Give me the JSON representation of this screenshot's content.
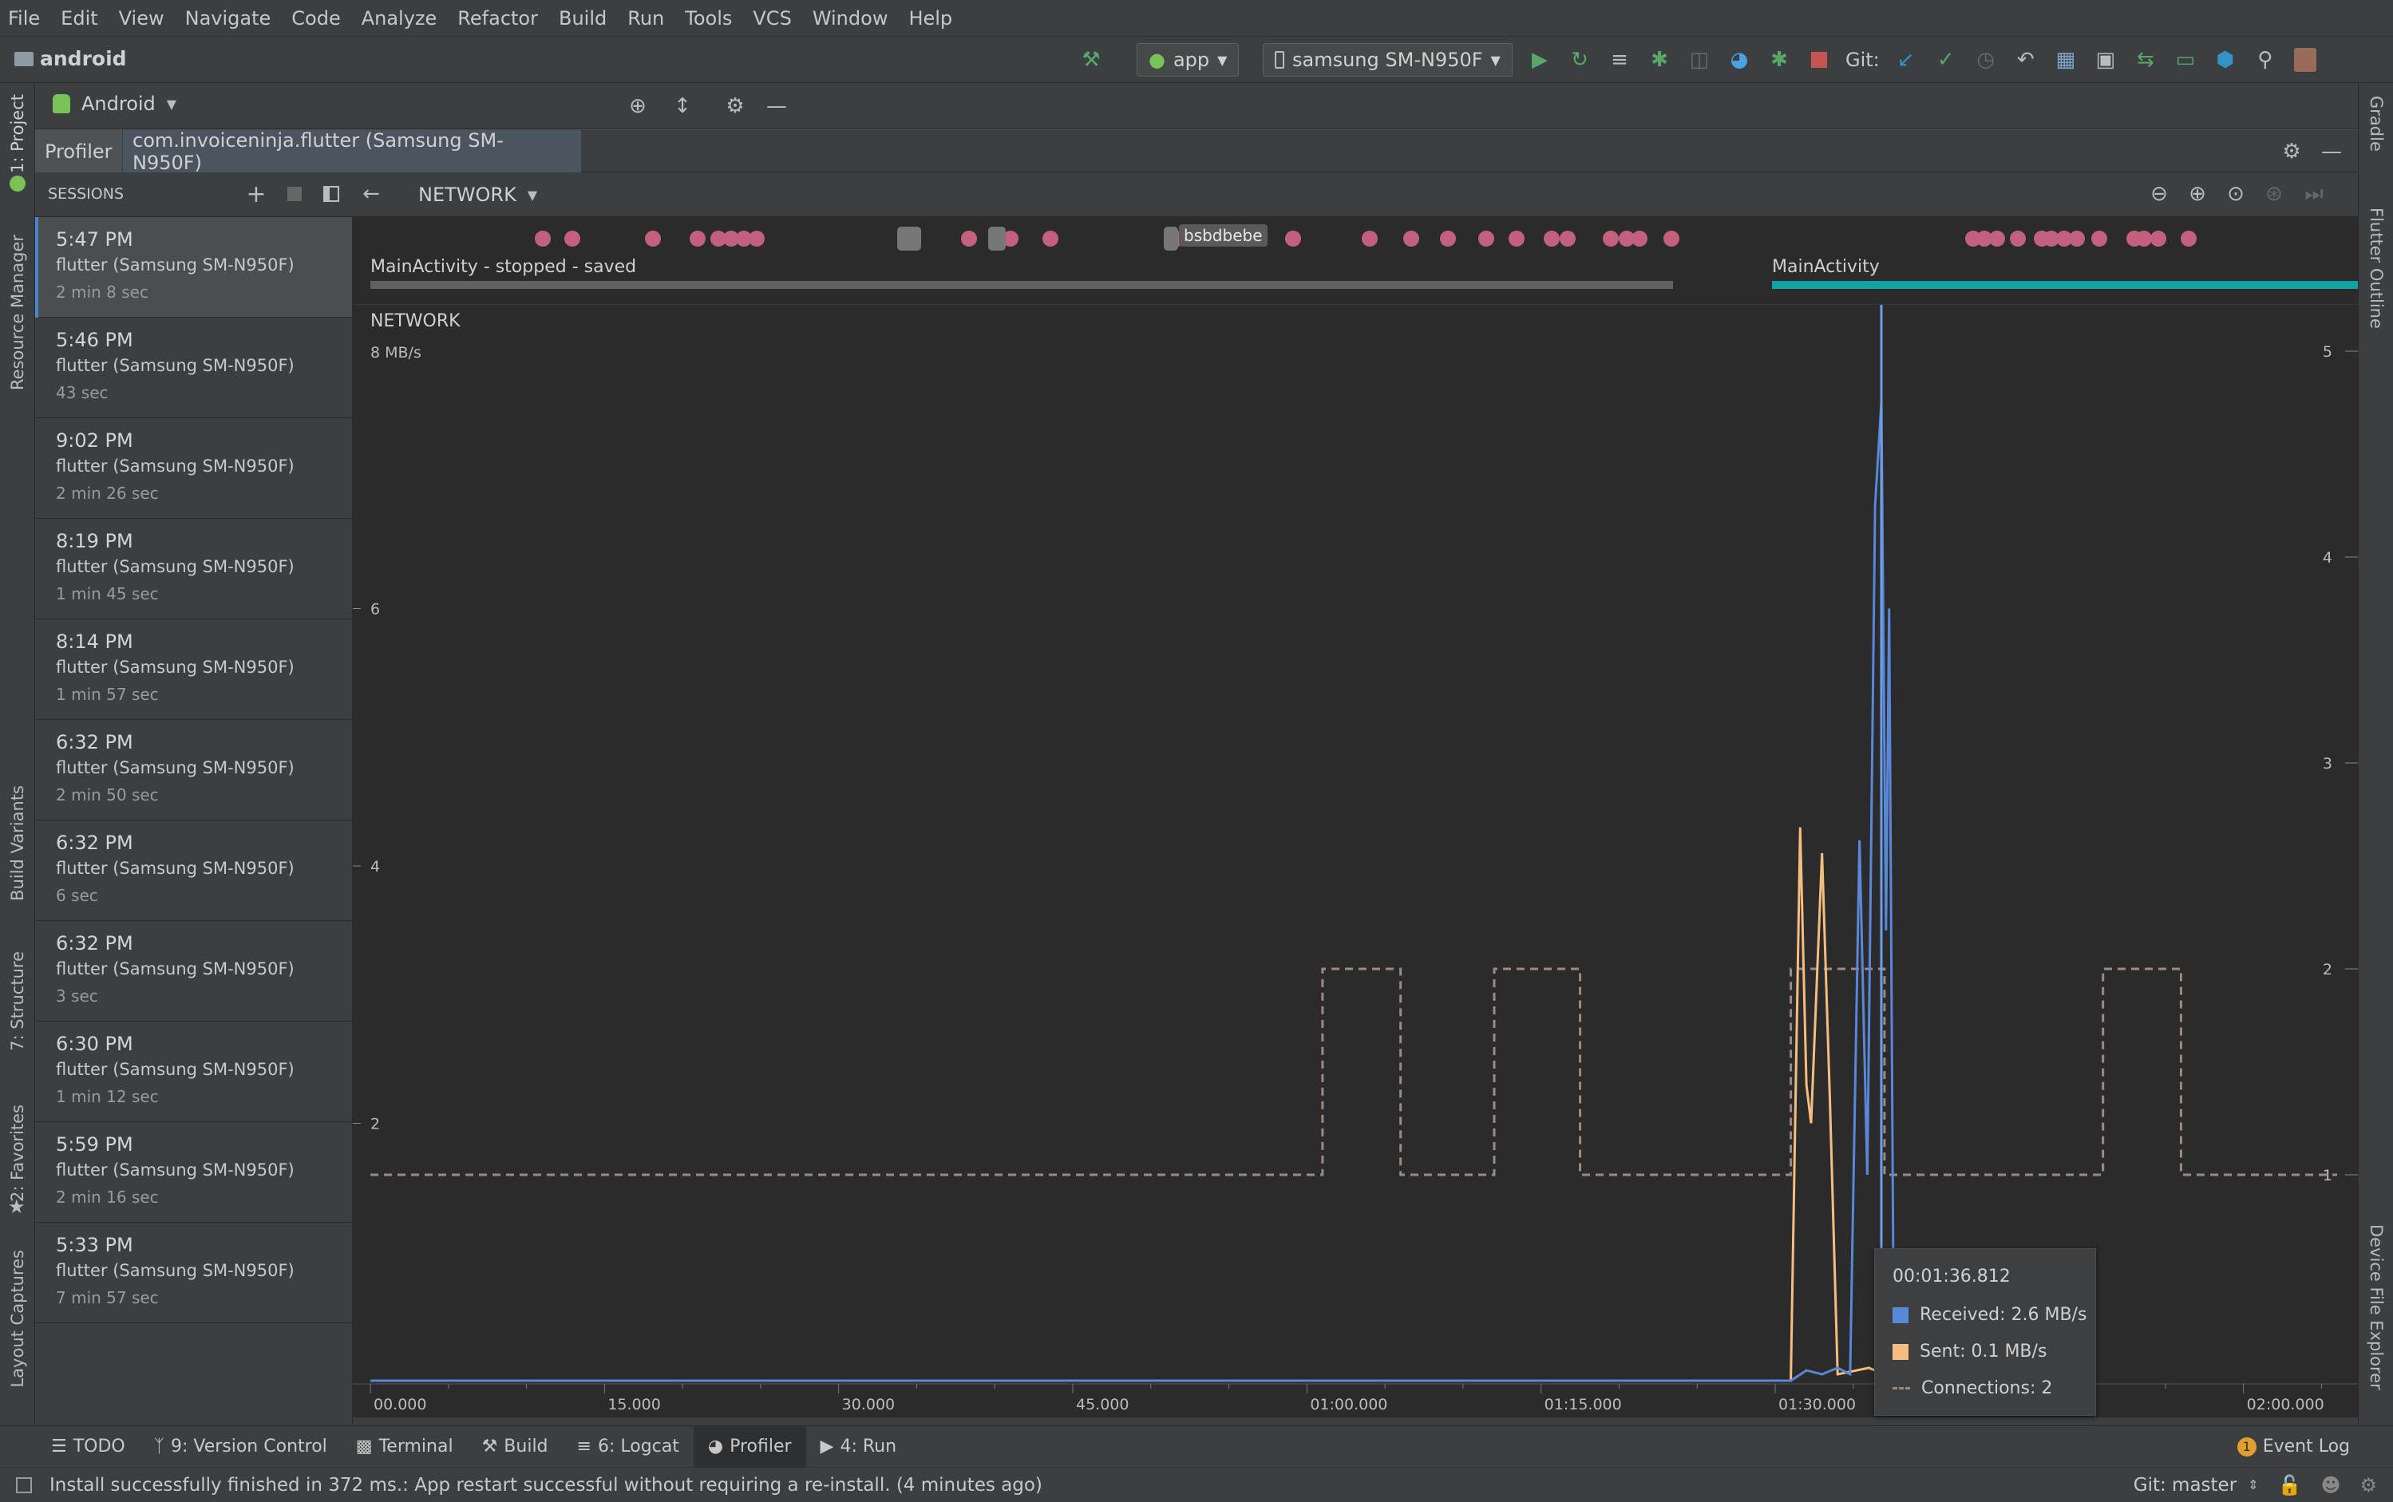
{
  "menu": [
    "File",
    "Edit",
    "View",
    "Navigate",
    "Code",
    "Analyze",
    "Refactor",
    "Build",
    "Run",
    "Tools",
    "VCS",
    "Window",
    "Help"
  ],
  "project_name": "android",
  "run_config": "app",
  "device": "samsung SM-N950F",
  "git_label": "Git:",
  "project_view": "Android",
  "left_tools": {
    "project": "1: Project",
    "resource": "Resource Manager",
    "variants": "Build Variants",
    "structure": "7: Structure",
    "favorites": "2: Favorites",
    "captures": "Layout Captures"
  },
  "right_tools": {
    "gradle": "Gradle",
    "flutter": "Flutter Outline",
    "device": "Device File Explorer"
  },
  "profiler_tabs": {
    "profiler": "Profiler",
    "process": "com.invoiceninja.flutter (Samsung SM-N950F)"
  },
  "sessions_label": "SESSIONS",
  "sessions": [
    {
      "time": "5:47 PM",
      "name": "flutter (Samsung SM-N950F)",
      "duration": "2 min 8 sec"
    },
    {
      "time": "5:46 PM",
      "name": "flutter (Samsung SM-N950F)",
      "duration": "43 sec"
    },
    {
      "time": "9:02 PM",
      "name": "flutter (Samsung SM-N950F)",
      "duration": "2 min 26 sec"
    },
    {
      "time": "8:19 PM",
      "name": "flutter (Samsung SM-N950F)",
      "duration": "1 min 45 sec"
    },
    {
      "time": "8:14 PM",
      "name": "flutter (Samsung SM-N950F)",
      "duration": "1 min 57 sec"
    },
    {
      "time": "6:32 PM",
      "name": "flutter (Samsung SM-N950F)",
      "duration": "2 min 50 sec"
    },
    {
      "time": "6:32 PM",
      "name": "flutter (Samsung SM-N950F)",
      "duration": "6 sec"
    },
    {
      "time": "6:32 PM",
      "name": "flutter (Samsung SM-N950F)",
      "duration": "3 sec"
    },
    {
      "time": "6:30 PM",
      "name": "flutter (Samsung SM-N950F)",
      "duration": "1 min 12 sec"
    },
    {
      "time": "5:59 PM",
      "name": "flutter (Samsung SM-N950F)",
      "duration": "2 min 16 sec"
    },
    {
      "time": "5:33 PM",
      "name": "flutter (Samsung SM-N950F)",
      "duration": "7 min 57 sec"
    }
  ],
  "monitor": "NETWORK",
  "event_tag": "bsbdbebe",
  "activities": {
    "first": "MainActivity - stopped - saved",
    "second": "MainActivity"
  },
  "chart_data": {
    "type": "line",
    "title": "NETWORK",
    "y_left_unit": "8 MB/s",
    "y_left_ticks": [
      "2",
      "4",
      "6"
    ],
    "y_right_ticks": [
      "1",
      "2",
      "3",
      "4",
      "5"
    ],
    "x_ticks": [
      "00.000",
      "15.000",
      "30.000",
      "45.000",
      "01:00.000",
      "01:15.000",
      "01:30.000",
      "02:00.000"
    ],
    "xlim_sec": [
      0,
      126
    ],
    "ylim_left_mb": [
      0,
      8
    ],
    "ylim_right": [
      0,
      5
    ],
    "colors": {
      "received": "#5b87d8",
      "sent": "#f5bd7f",
      "connections": "#9c8a82",
      "cursor": "#6e9ee8"
    },
    "series": [
      {
        "key": "sent",
        "points": [
          [
            0,
            0
          ],
          [
            91.0,
            0
          ],
          [
            91.6,
            4.3
          ],
          [
            92.0,
            2.3
          ],
          [
            92.3,
            2.0
          ],
          [
            93.0,
            4.1
          ],
          [
            93.5,
            2.2
          ],
          [
            94.0,
            0.05
          ],
          [
            96.0,
            0.1
          ],
          [
            97.0,
            0.05
          ],
          [
            99.0,
            0
          ]
        ]
      },
      {
        "key": "received",
        "points": [
          [
            0,
            0
          ],
          [
            91.0,
            0
          ],
          [
            92.0,
            0.08
          ],
          [
            93.0,
            0.05
          ],
          [
            94.0,
            0.1
          ],
          [
            94.8,
            0.05
          ],
          [
            95.4,
            4.2
          ],
          [
            95.9,
            1.6
          ],
          [
            96.4,
            6.8
          ],
          [
            96.8,
            7.6
          ],
          [
            97.1,
            3.5
          ],
          [
            97.3,
            6.0
          ],
          [
            97.6,
            0.2
          ],
          [
            98.0,
            0
          ]
        ]
      },
      {
        "key": "connections",
        "points": [
          [
            0,
            1
          ],
          [
            61,
            1
          ],
          [
            61,
            2
          ],
          [
            66,
            2
          ],
          [
            66,
            1
          ],
          [
            72,
            1
          ],
          [
            72,
            2
          ],
          [
            77.5,
            2
          ],
          [
            77.5,
            1
          ],
          [
            91,
            1
          ],
          [
            91,
            2
          ],
          [
            97,
            2
          ],
          [
            97,
            1
          ],
          [
            111,
            1
          ],
          [
            111,
            2
          ],
          [
            116,
            2
          ],
          [
            116,
            1
          ],
          [
            126,
            1
          ]
        ]
      }
    ],
    "cursor_sec": 96.8
  },
  "tooltip": {
    "time": "00:01:36.812",
    "received": "Received: 2.6 MB/s",
    "sent": "Sent: 0.1 MB/s",
    "connections": "Connections: 2"
  },
  "bottom_tools": [
    "TODO",
    "9: Version Control",
    "Terminal",
    "Build",
    "6: Logcat",
    "Profiler",
    "4: Run"
  ],
  "event_log": "Event Log",
  "event_log_count": "1",
  "status_message": "Install successfully finished in 372 ms.: App restart successful without requiring a re-install. (4 minutes ago)",
  "git_branch": "Git: master"
}
